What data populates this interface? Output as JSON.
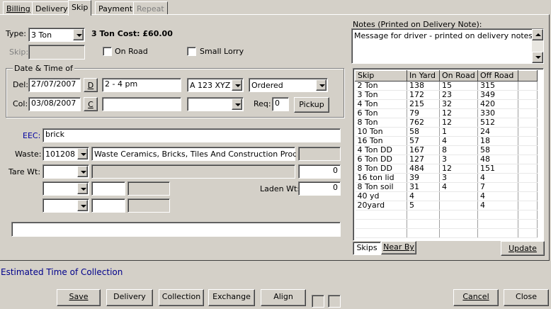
{
  "tabs": [
    {
      "label": "Billing",
      "active": false,
      "enabled": true
    },
    {
      "label": "Delivery",
      "active": false,
      "enabled": true
    },
    {
      "label": "Skip",
      "active": true,
      "enabled": true
    },
    {
      "label": "Payment",
      "active": false,
      "enabled": true
    },
    {
      "label": "Repeat",
      "active": false,
      "enabled": false
    }
  ],
  "skip": {
    "type_label": "Type:",
    "type_value": "3 Ton",
    "cost_text": "3 Ton Cost: £60.00",
    "skip_label": "Skip:",
    "skip_value": "",
    "on_road_label": "On Road",
    "small_lorry_label": "Small Lorry"
  },
  "datetime": {
    "group_label": "Date & Time of",
    "del_label": "Del:",
    "del_date": "27/07/2007",
    "del_button": "D",
    "del_time": "2 - 4 pm",
    "del_vehicle": "A 123 XYZ",
    "del_status": "Ordered",
    "col_label": "Col:",
    "col_date": "03/08/2007",
    "col_button": "C",
    "col_time": "",
    "col_vehicle": "",
    "req_label": "Req:",
    "req_value": "0",
    "pickup_label": "Pickup"
  },
  "waste": {
    "eec_label": "EEC:",
    "eec_value": "brick",
    "waste_label": "Waste:",
    "waste_code": "101208",
    "waste_desc": "Waste Ceramics, Bricks, Tiles And Construction Products Af",
    "tare_label": "Tare Wt:",
    "tare_value": "0",
    "laden_label": "Laden Wt:",
    "laden_value": "0"
  },
  "notes": {
    "label": "Notes (Printed on Delivery Note):",
    "value": "Message for driver - printed on delivery notes."
  },
  "grid": {
    "headers": [
      "Skip",
      "In Yard",
      "On Road",
      "Off Road"
    ],
    "rows": [
      [
        "2 Ton",
        "138",
        "15",
        "315"
      ],
      [
        "3 Ton",
        "172",
        "23",
        "349"
      ],
      [
        "4 Ton",
        "215",
        "32",
        "420"
      ],
      [
        "6 Ton",
        "79",
        "12",
        "330"
      ],
      [
        "8 Ton",
        "762",
        "12",
        "512"
      ],
      [
        "10 Ton",
        "58",
        "1",
        "24"
      ],
      [
        "16 Ton",
        "57",
        "4",
        "18"
      ],
      [
        "4 Ton DD",
        "167",
        "8",
        "58"
      ],
      [
        "6 Ton DD",
        "127",
        "3",
        "48"
      ],
      [
        "8 Ton DD",
        "484",
        "12",
        "151"
      ],
      [
        "16 ton lid",
        "39",
        "3",
        "4"
      ],
      [
        "8 Ton soil",
        "31",
        "4",
        "7"
      ],
      [
        "40 yd",
        "4",
        "",
        "4"
      ],
      [
        "20yard",
        "5",
        "",
        "4"
      ]
    ],
    "tab_skips": "Skips",
    "tab_nearby": "Near By",
    "update_label": "Update"
  },
  "status_text": "Estimated Time of Collection",
  "buttons": {
    "save": "Save",
    "delivery": "Delivery",
    "collection": "Collection",
    "exchange": "Exchange",
    "align": "Align",
    "cancel": "Cancel",
    "close": "Close"
  },
  "colors": {
    "background": "#d4d0c8",
    "status_text": "#00008b",
    "eec_label": "#0000a0"
  }
}
